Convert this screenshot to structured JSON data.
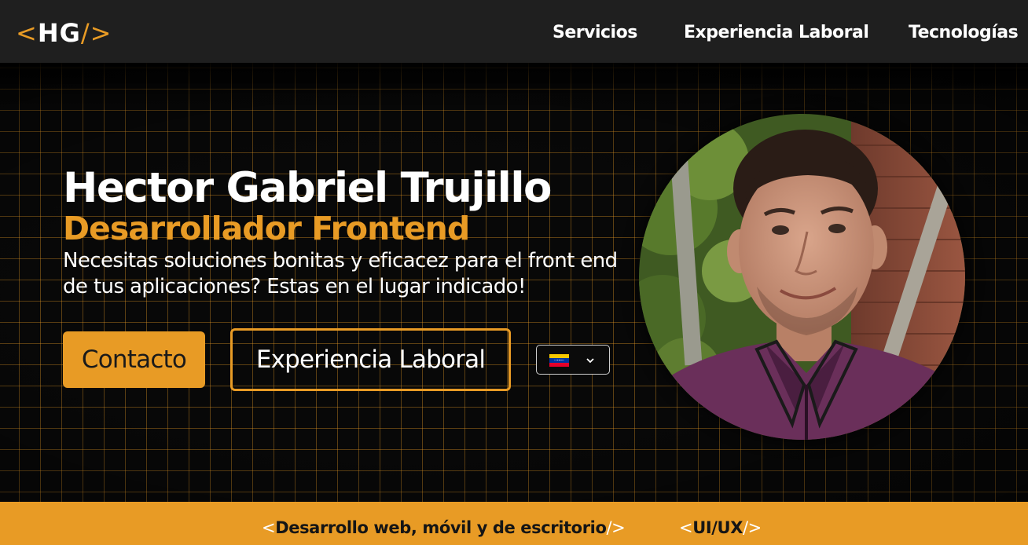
{
  "nav": {
    "logo": {
      "open": "<",
      "text": "HG",
      "close": "/>"
    },
    "links": [
      "Servicios",
      "Experiencia Laboral",
      "Tecnologías"
    ]
  },
  "hero": {
    "name": "Hector Gabriel Trujillo",
    "role": "Desarrollador Frontend",
    "tagline": "Necesitas soluciones bonitas y eficacez para el front end de tus aplicaciones? Estas en el lugar indicado!",
    "contact_button": "Contacto",
    "experience_button": "Experiencia Laboral",
    "language_selector": {
      "selected_icon": "venezuela-flag-icon",
      "dropdown_icon": "chevron-down-icon"
    },
    "avatar_icon": "profile-photo"
  },
  "banner": {
    "items": [
      {
        "open": "<",
        "text": "Desarrollo web, móvil y de escritorio",
        "close": "/>"
      },
      {
        "open": "<",
        "text": "UI/UX",
        "close": "/>"
      }
    ]
  },
  "colors": {
    "accent": "#e89b25",
    "navbar": "#1f1f1f",
    "background": "#0b0b0b",
    "text": "#ffffff"
  }
}
